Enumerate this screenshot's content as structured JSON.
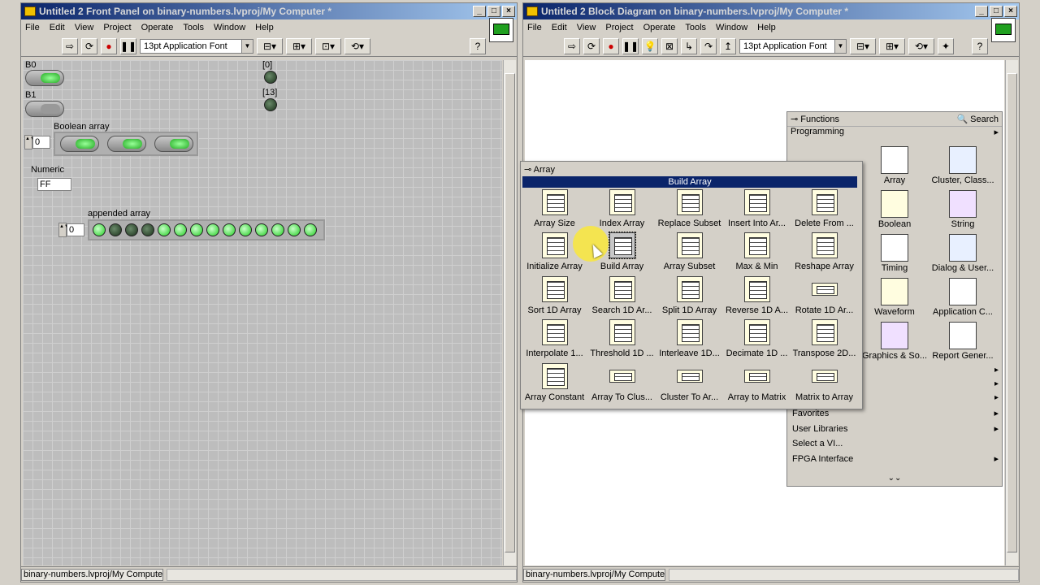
{
  "front_panel": {
    "title": "Untitled 2 Front Panel on binary-numbers.lvproj/My Computer *",
    "menus": [
      "File",
      "Edit",
      "View",
      "Project",
      "Operate",
      "Tools",
      "Window",
      "Help"
    ],
    "font_select": "13pt Application Font",
    "controls": {
      "b0_label": "B0",
      "b1_label": "B1",
      "ind0_label": "[0]",
      "ind13_label": "[13]",
      "bool_array_label": "Boolean array",
      "bool_array_index": "0",
      "numeric_label": "Numeric",
      "numeric_value": "FF",
      "appended_label": "appended array",
      "appended_index": "0"
    },
    "status_path": "binary-numbers.lvproj/My Computer"
  },
  "block_diagram": {
    "title": "Untitled 2 Block Diagram on binary-numbers.lvproj/My Computer *",
    "menus": [
      "File",
      "Edit",
      "View",
      "Project",
      "Operate",
      "Tools",
      "Window",
      "Help"
    ],
    "font_select": "13pt Application Font",
    "status_path": "binary-numbers.lvproj/My Computer"
  },
  "functions_palette": {
    "title": "Functions",
    "search_label": "Search",
    "category": "Programming",
    "items": [
      "Array",
      "Cluster, Class...",
      "Boolean",
      "String",
      "Timing",
      "Dialog & User...",
      "Waveform",
      "Application C...",
      "Graphics & So...",
      "Report Gener..."
    ],
    "list": [
      "Favorites",
      "User Libraries",
      "Select a VI...",
      "FPGA Interface"
    ]
  },
  "array_palette": {
    "title": "Array",
    "highlight": "Build Array",
    "items": [
      "Array Size",
      "Index Array",
      "Replace Subset",
      "Insert Into Ar...",
      "Delete From ...",
      "Initialize Array",
      "Build Array",
      "Array Subset",
      "Max & Min",
      "Reshape Array",
      "Sort 1D Array",
      "Search 1D Ar...",
      "Split 1D Array",
      "Reverse 1D A...",
      "Rotate 1D Ar...",
      "Interpolate 1...",
      "Threshold 1D ...",
      "Interleave 1D...",
      "Decimate 1D ...",
      "Transpose 2D...",
      "Array Constant",
      "Array To Clus...",
      "Cluster To Ar...",
      "Array to Matrix",
      "Matrix to Array"
    ]
  }
}
